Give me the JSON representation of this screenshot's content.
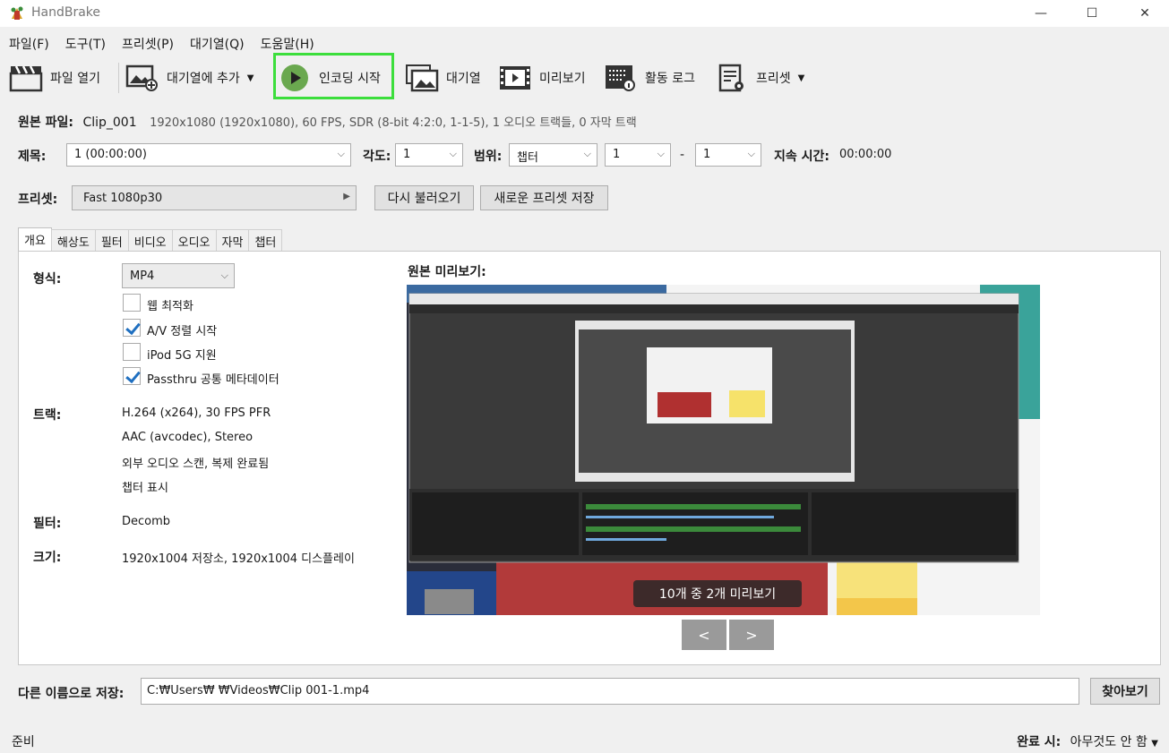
{
  "window": {
    "title": "HandBrake",
    "minimize": "—",
    "maximize": "☐",
    "close": "✕"
  },
  "menu": [
    "파일(F)",
    "도구(T)",
    "프리셋(P)",
    "대기열(Q)",
    "도움말(H)"
  ],
  "toolbar": {
    "open": "파일 열기",
    "add_queue": "대기열에 추가",
    "start": "인코딩 시작",
    "queue": "대기열",
    "preview": "미리보기",
    "activity": "활동 로그",
    "presets": "프리셋"
  },
  "source": {
    "label": "원본 파일:",
    "name": "Clip_001",
    "info": "1920x1080 (1920x1080), 60 FPS, SDR (8-bit 4:2:0, 1-1-5), 1 오디오 트랙들, 0 자막 트랙"
  },
  "title_row": {
    "title_label": "제목:",
    "title_value": "1  (00:00:00)",
    "angle_label": "각도:",
    "angle_value": "1",
    "range_label": "범위:",
    "range_value": "챕터",
    "range_from": "1",
    "dash": "-",
    "range_to": "1",
    "duration_label": "지속 시간:",
    "duration_value": "00:00:00"
  },
  "preset_row": {
    "label": "프리셋:",
    "value": "Fast 1080p30",
    "reload": "다시 불러오기",
    "save_new": "새로운 프리셋 저장"
  },
  "tabs": [
    "개요",
    "해상도",
    "필터",
    "비디오",
    "오디오",
    "자막",
    "챕터"
  ],
  "summary": {
    "format_label": "형식:",
    "format_value": "MP4",
    "options": [
      {
        "label": "웹 최적화",
        "checked": false
      },
      {
        "label": "A/V 정렬 시작",
        "checked": true
      },
      {
        "label": "iPod 5G 지원",
        "checked": false
      },
      {
        "label": "Passthru 공통 메타데이터",
        "checked": true
      }
    ],
    "tracks_label": "트랙:",
    "tracks": [
      "H.264 (x264), 30 FPS PFR",
      "AAC (avcodec), Stereo",
      "외부 오디오 스캔, 복제 완료됨",
      "챕터 표시"
    ],
    "filters_label": "필터:",
    "filters_value": "Decomb",
    "size_label": "크기:",
    "size_value": "1920x1004 저장소, 1920x1004 디스플레이"
  },
  "preview": {
    "title": "원본 미리보기:",
    "counter": "10개 중 2개 미리보기",
    "prev": "<",
    "next": ">"
  },
  "save": {
    "label": "다른 이름으로 저장:",
    "path": "C:₩Users₩      ₩Videos₩Clip 001-1.mp4",
    "browse": "찾아보기"
  },
  "status": {
    "left": "준비",
    "done_label": "완료 시:",
    "done_value": "아무것도 안 함"
  },
  "colors": {
    "highlight": "#3cde3c",
    "check": "#1f6fc0"
  }
}
